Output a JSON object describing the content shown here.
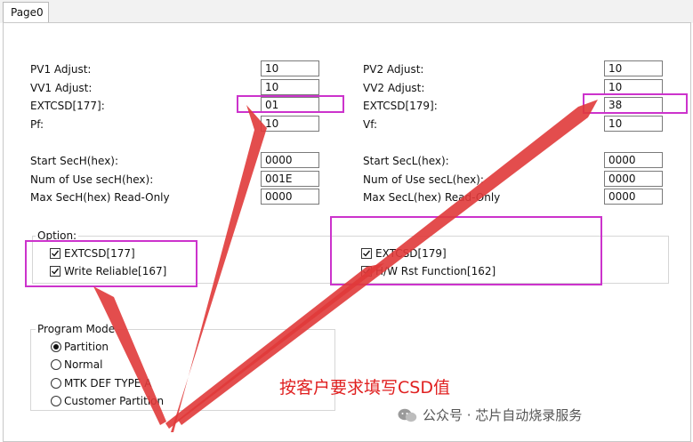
{
  "tab": {
    "label": "Page0"
  },
  "left": {
    "pv1_label": "PV1 Adjust:",
    "pv1_value": "10",
    "vv1_label": "VV1 Adjust:",
    "vv1_value": "10",
    "extcsd_label": "EXTCSD[177]:",
    "extcsd_value": "01",
    "pf_label": "Pf:",
    "pf_value": "10",
    "start_label": "Start SecH(hex):",
    "start_value": "0000",
    "num_label": "Num of Use secH(hex):",
    "num_value": "001E",
    "max_label": "Max SecH(hex) Read-Only",
    "max_value": "0000"
  },
  "right": {
    "pv2_label": "PV2 Adjust:",
    "pv2_value": "10",
    "vv2_label": "VV2 Adjust:",
    "vv2_value": "10",
    "extcsd_label": "EXTCSD[179]:",
    "extcsd_value": "38",
    "vf_label": "Vf:",
    "vf_value": "10",
    "start_label": "Start SecL(hex):",
    "start_value": "0000",
    "num_label": "Num of Use secL(hex):",
    "num_value": "0000",
    "max_label": "Max SecL(hex) Read-Only",
    "max_value": "0000"
  },
  "option": {
    "title": "Option:",
    "items": [
      {
        "label": "EXTCSD[177]",
        "checked": true
      },
      {
        "label": "Write Reliable[167]",
        "checked": true
      },
      {
        "label": "EXTCSD[179]",
        "checked": true
      },
      {
        "label": "H/W Rst Function[162]",
        "checked": true
      }
    ]
  },
  "program_mode": {
    "title": "Program Mode",
    "options": [
      {
        "label": "Partition",
        "selected": true
      },
      {
        "label": "Normal",
        "selected": false
      },
      {
        "label": "MTK DEF TYPE A",
        "selected": false
      },
      {
        "label": "Customer Partition",
        "selected": false
      }
    ]
  },
  "annotation": {
    "text": "按客户要求填写CSD值",
    "color": "#e02020",
    "highlight_color": "#cc33cc"
  },
  "watermark": {
    "text": "公众号 · 芯片自动烧录服务"
  }
}
